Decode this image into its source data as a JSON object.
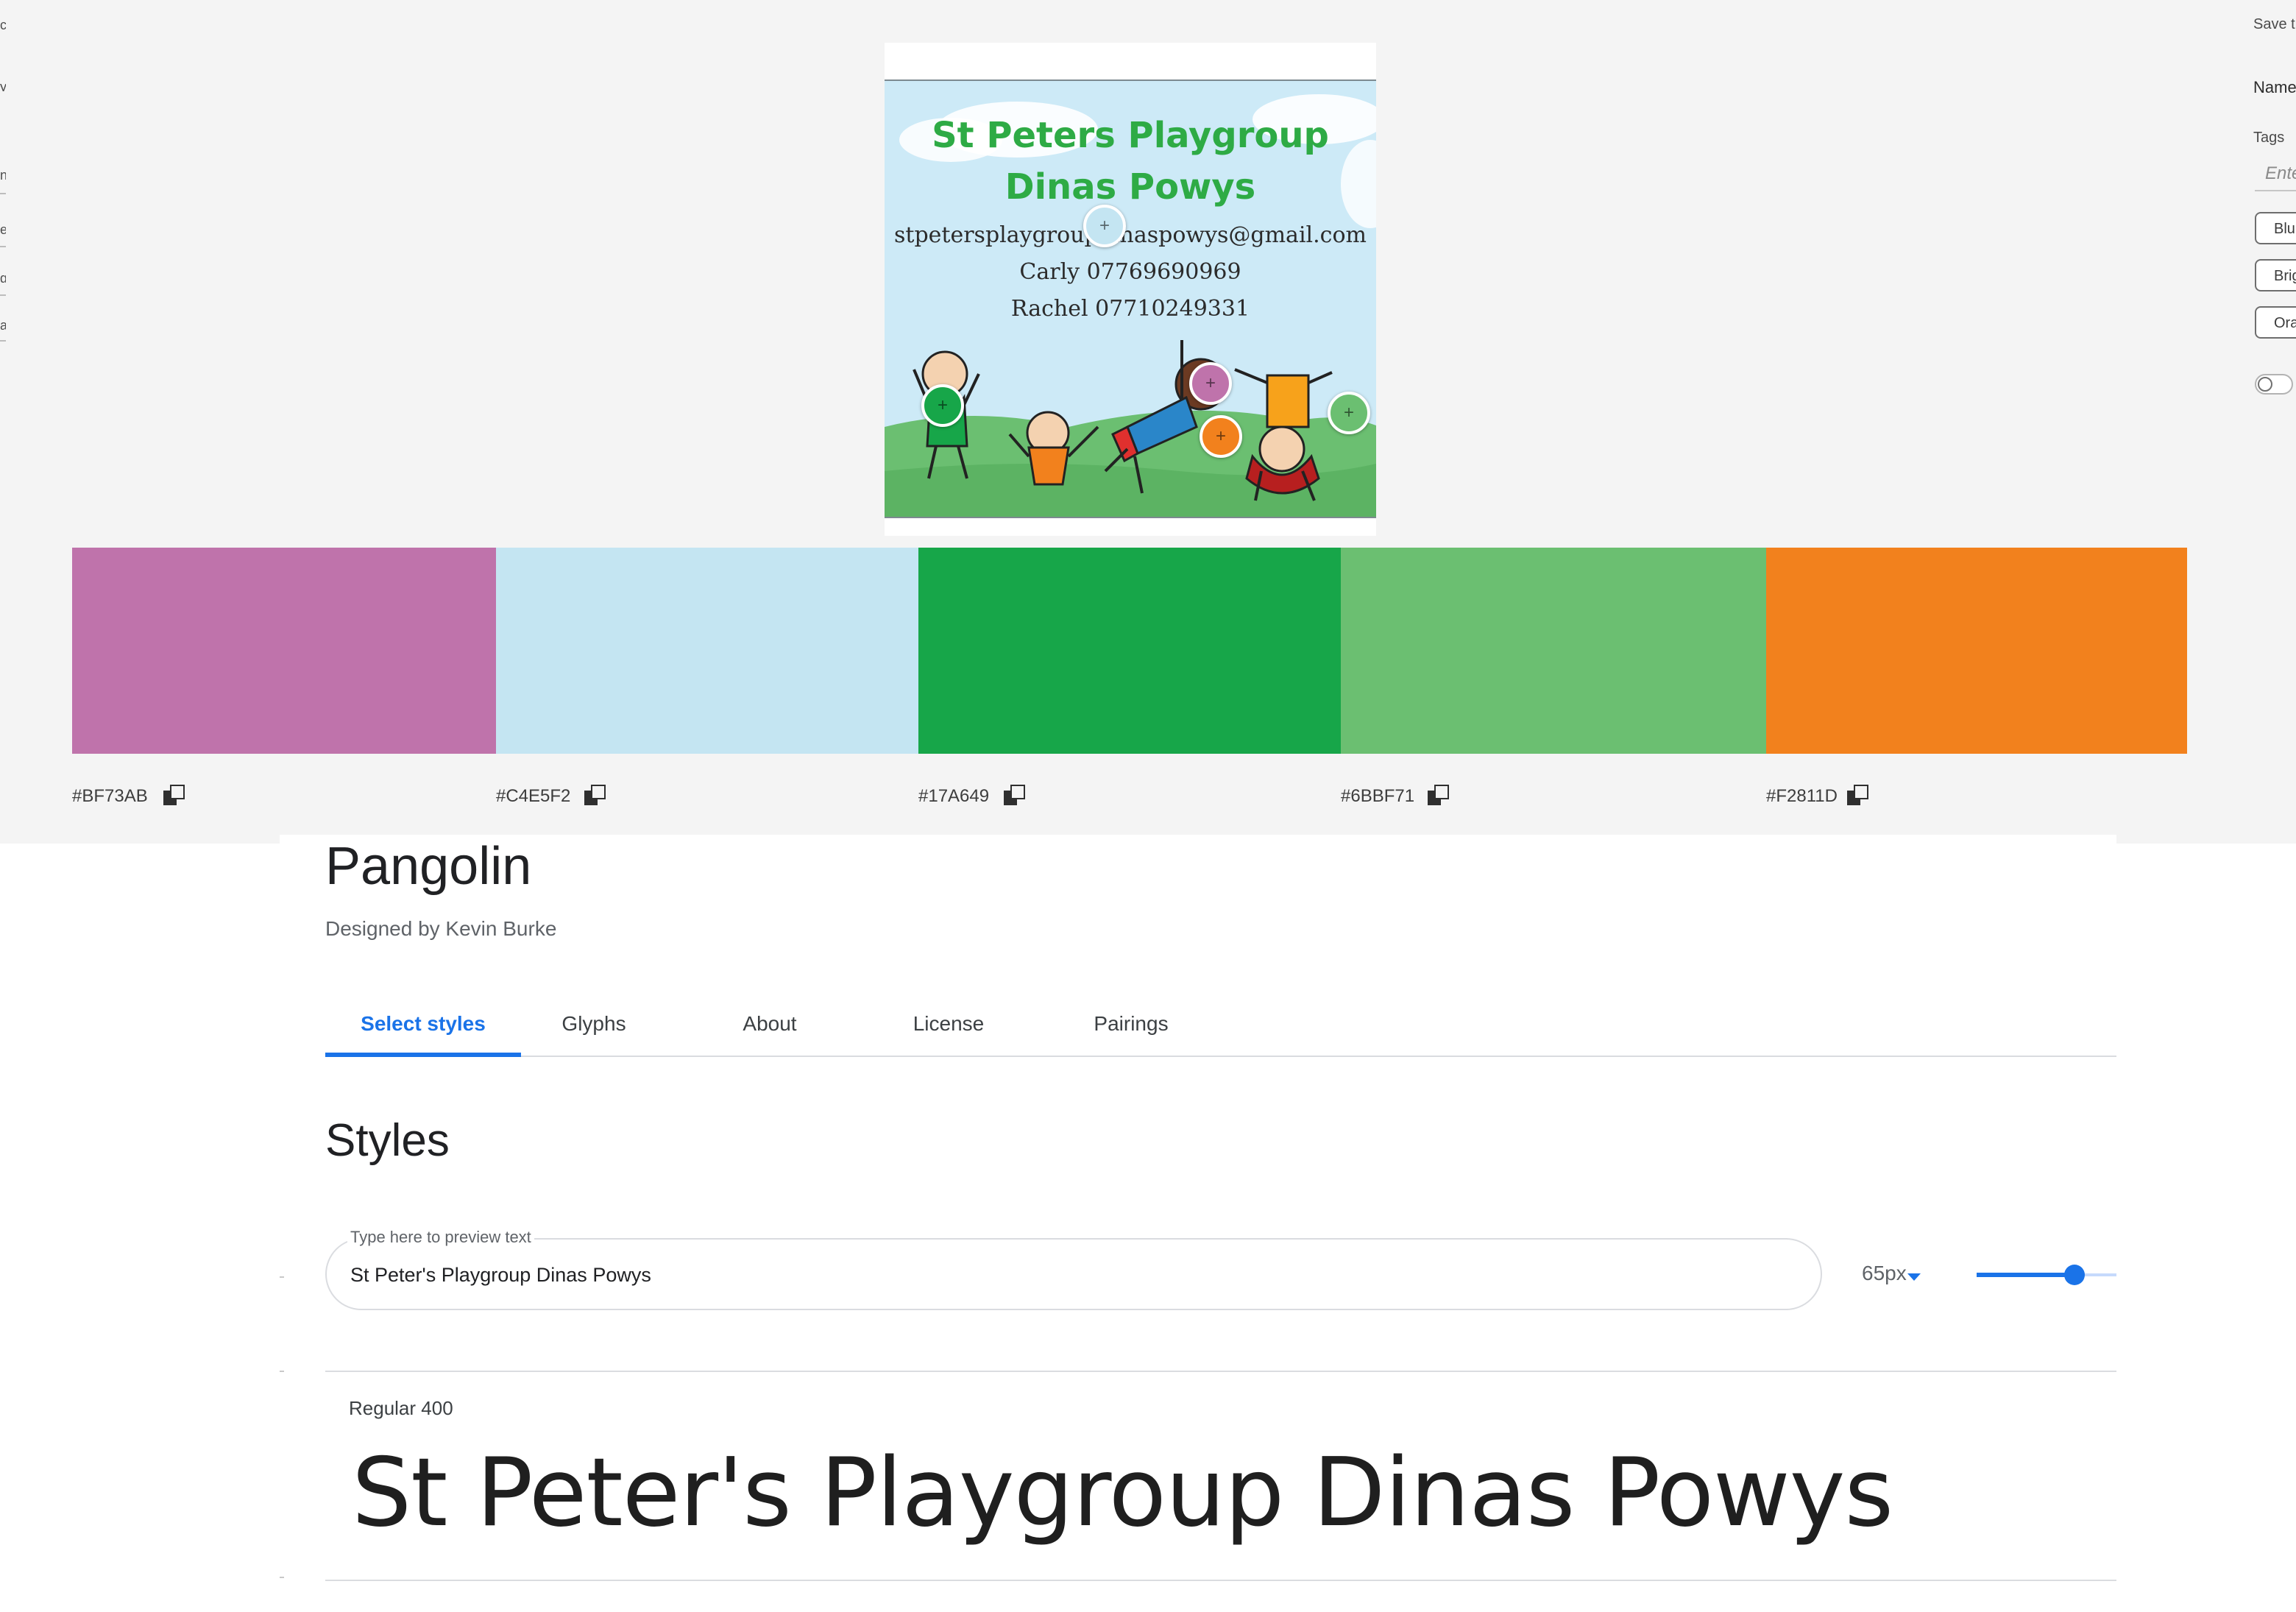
{
  "theme_panel": {
    "left_labels": [
      "c",
      "y",
      "n",
      "e",
      "g",
      "a"
    ],
    "right_panel": {
      "save_label": "Save t",
      "name_label": "Name",
      "tags_label": "Tags",
      "tags_placeholder": "Ente",
      "tags": [
        "Blu",
        "Brig",
        "Ora"
      ]
    },
    "source_image": {
      "title_line1": "St Peters Playgroup",
      "title_line2": "Dinas Powys",
      "email": "stpetersplaygroupdinaspowys@gmail.com",
      "contact1": "Carly 07769690969",
      "contact2": "Rachel 07710249331"
    },
    "pickers": [
      {
        "name": "picker-sky",
        "color": "#C4E5F2"
      },
      {
        "name": "picker-pink",
        "color": "#BF73AB"
      },
      {
        "name": "picker-dark-green",
        "color": "#17A649"
      },
      {
        "name": "picker-orange",
        "color": "#F2811D"
      },
      {
        "name": "picker-light-green",
        "color": "#6BBF71"
      }
    ],
    "swatches": [
      {
        "hex": "#BF73AB",
        "color": "#BF73AB",
        "icon": "copy-icon"
      },
      {
        "hex": "#C4E5F2",
        "color": "#C4E5F2",
        "icon": "copy-icon"
      },
      {
        "hex": "#17A649",
        "color": "#17A649",
        "icon": "copy-icon"
      },
      {
        "hex": "#6BBF71",
        "color": "#6BBF71",
        "icon": "copy-icon"
      },
      {
        "hex": "#F2811D",
        "color": "#F2811D",
        "icon": "copy-icon"
      }
    ]
  },
  "font_page": {
    "title": "Pangolin",
    "designer": "Designed by Kevin Burke",
    "tabs": [
      "Select styles",
      "Glyphs",
      "About",
      "License",
      "Pairings"
    ],
    "active_tab": "Select styles",
    "styles_heading": "Styles",
    "preview": {
      "label": "Type here to preview text",
      "value": "St Peter's Playgroup Dinas Powys"
    },
    "size": "65px",
    "size_slider_fraction": 0.7,
    "style": {
      "name": "Regular 400",
      "sample": "St Peter's Playgroup Dinas Powys"
    },
    "accent_color": "#1a73e8"
  }
}
